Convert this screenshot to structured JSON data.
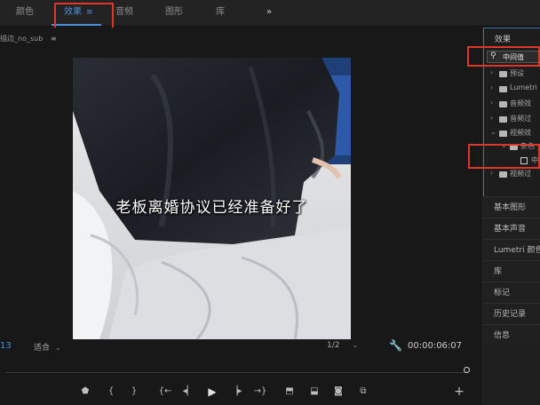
{
  "workspace_tabs": [
    {
      "label": "颜色",
      "active": false
    },
    {
      "label": "效果",
      "active": true,
      "menu_icon": "menu-lines-icon"
    },
    {
      "label": "音频",
      "active": false
    },
    {
      "label": "图形",
      "active": false
    },
    {
      "label": "库",
      "active": false
    }
  ],
  "workspace_more": "»",
  "monitor": {
    "sequence_name": "描边_no_sub",
    "sequence_menu": "≡",
    "subtitle": "老板离婚协议已经准备好了",
    "timecode_left": "13",
    "fit_label": "适合",
    "resolution_label": "1/2",
    "timecode_right": "00:00:06:07"
  },
  "transport": [
    {
      "name": "add-marker-icon",
      "glyph": "⬟"
    },
    {
      "name": "mark-in-icon",
      "glyph": "{"
    },
    {
      "name": "mark-out-icon",
      "glyph": "}"
    },
    {
      "name": "go-to-in-icon",
      "glyph": "{←"
    },
    {
      "name": "step-back-icon",
      "glyph": "◂▏"
    },
    {
      "name": "play-icon",
      "glyph": "▶"
    },
    {
      "name": "step-forward-icon",
      "glyph": "▕▸"
    },
    {
      "name": "go-to-out-icon",
      "glyph": "→}"
    },
    {
      "name": "lift-icon",
      "glyph": "⬒"
    },
    {
      "name": "extract-icon",
      "glyph": "⬓"
    },
    {
      "name": "export-frame-icon",
      "glyph": "◙"
    },
    {
      "name": "comparison-view-icon",
      "glyph": "⧉"
    },
    {
      "name": "add-button-icon",
      "glyph": "+"
    }
  ],
  "effects_panel": {
    "title": "效果",
    "search_value": "中间值",
    "tree": [
      {
        "label": "预设",
        "level": 0,
        "expanded": false,
        "kind": "folder"
      },
      {
        "label": "Lumetri",
        "level": 0,
        "expanded": false,
        "kind": "folder"
      },
      {
        "label": "音频效",
        "level": 0,
        "expanded": false,
        "kind": "folder"
      },
      {
        "label": "音频过",
        "level": 0,
        "expanded": false,
        "kind": "folder"
      },
      {
        "label": "视频效",
        "level": 0,
        "expanded": true,
        "kind": "folder"
      },
      {
        "label": "杂色",
        "level": 1,
        "expanded": true,
        "kind": "folder"
      },
      {
        "label": "中",
        "level": 2,
        "expanded": false,
        "kind": "effect"
      },
      {
        "label": "视频过",
        "level": 0,
        "expanded": false,
        "kind": "folder"
      }
    ]
  },
  "side_panels": [
    "基本图形",
    "基本声音",
    "Lumetri 颜色",
    "库",
    "标记",
    "历史记录",
    "信息"
  ],
  "colors": {
    "accent": "#4c8fe0",
    "annotation_red": "#e0352b",
    "panel_border": "#3f6fb0"
  }
}
